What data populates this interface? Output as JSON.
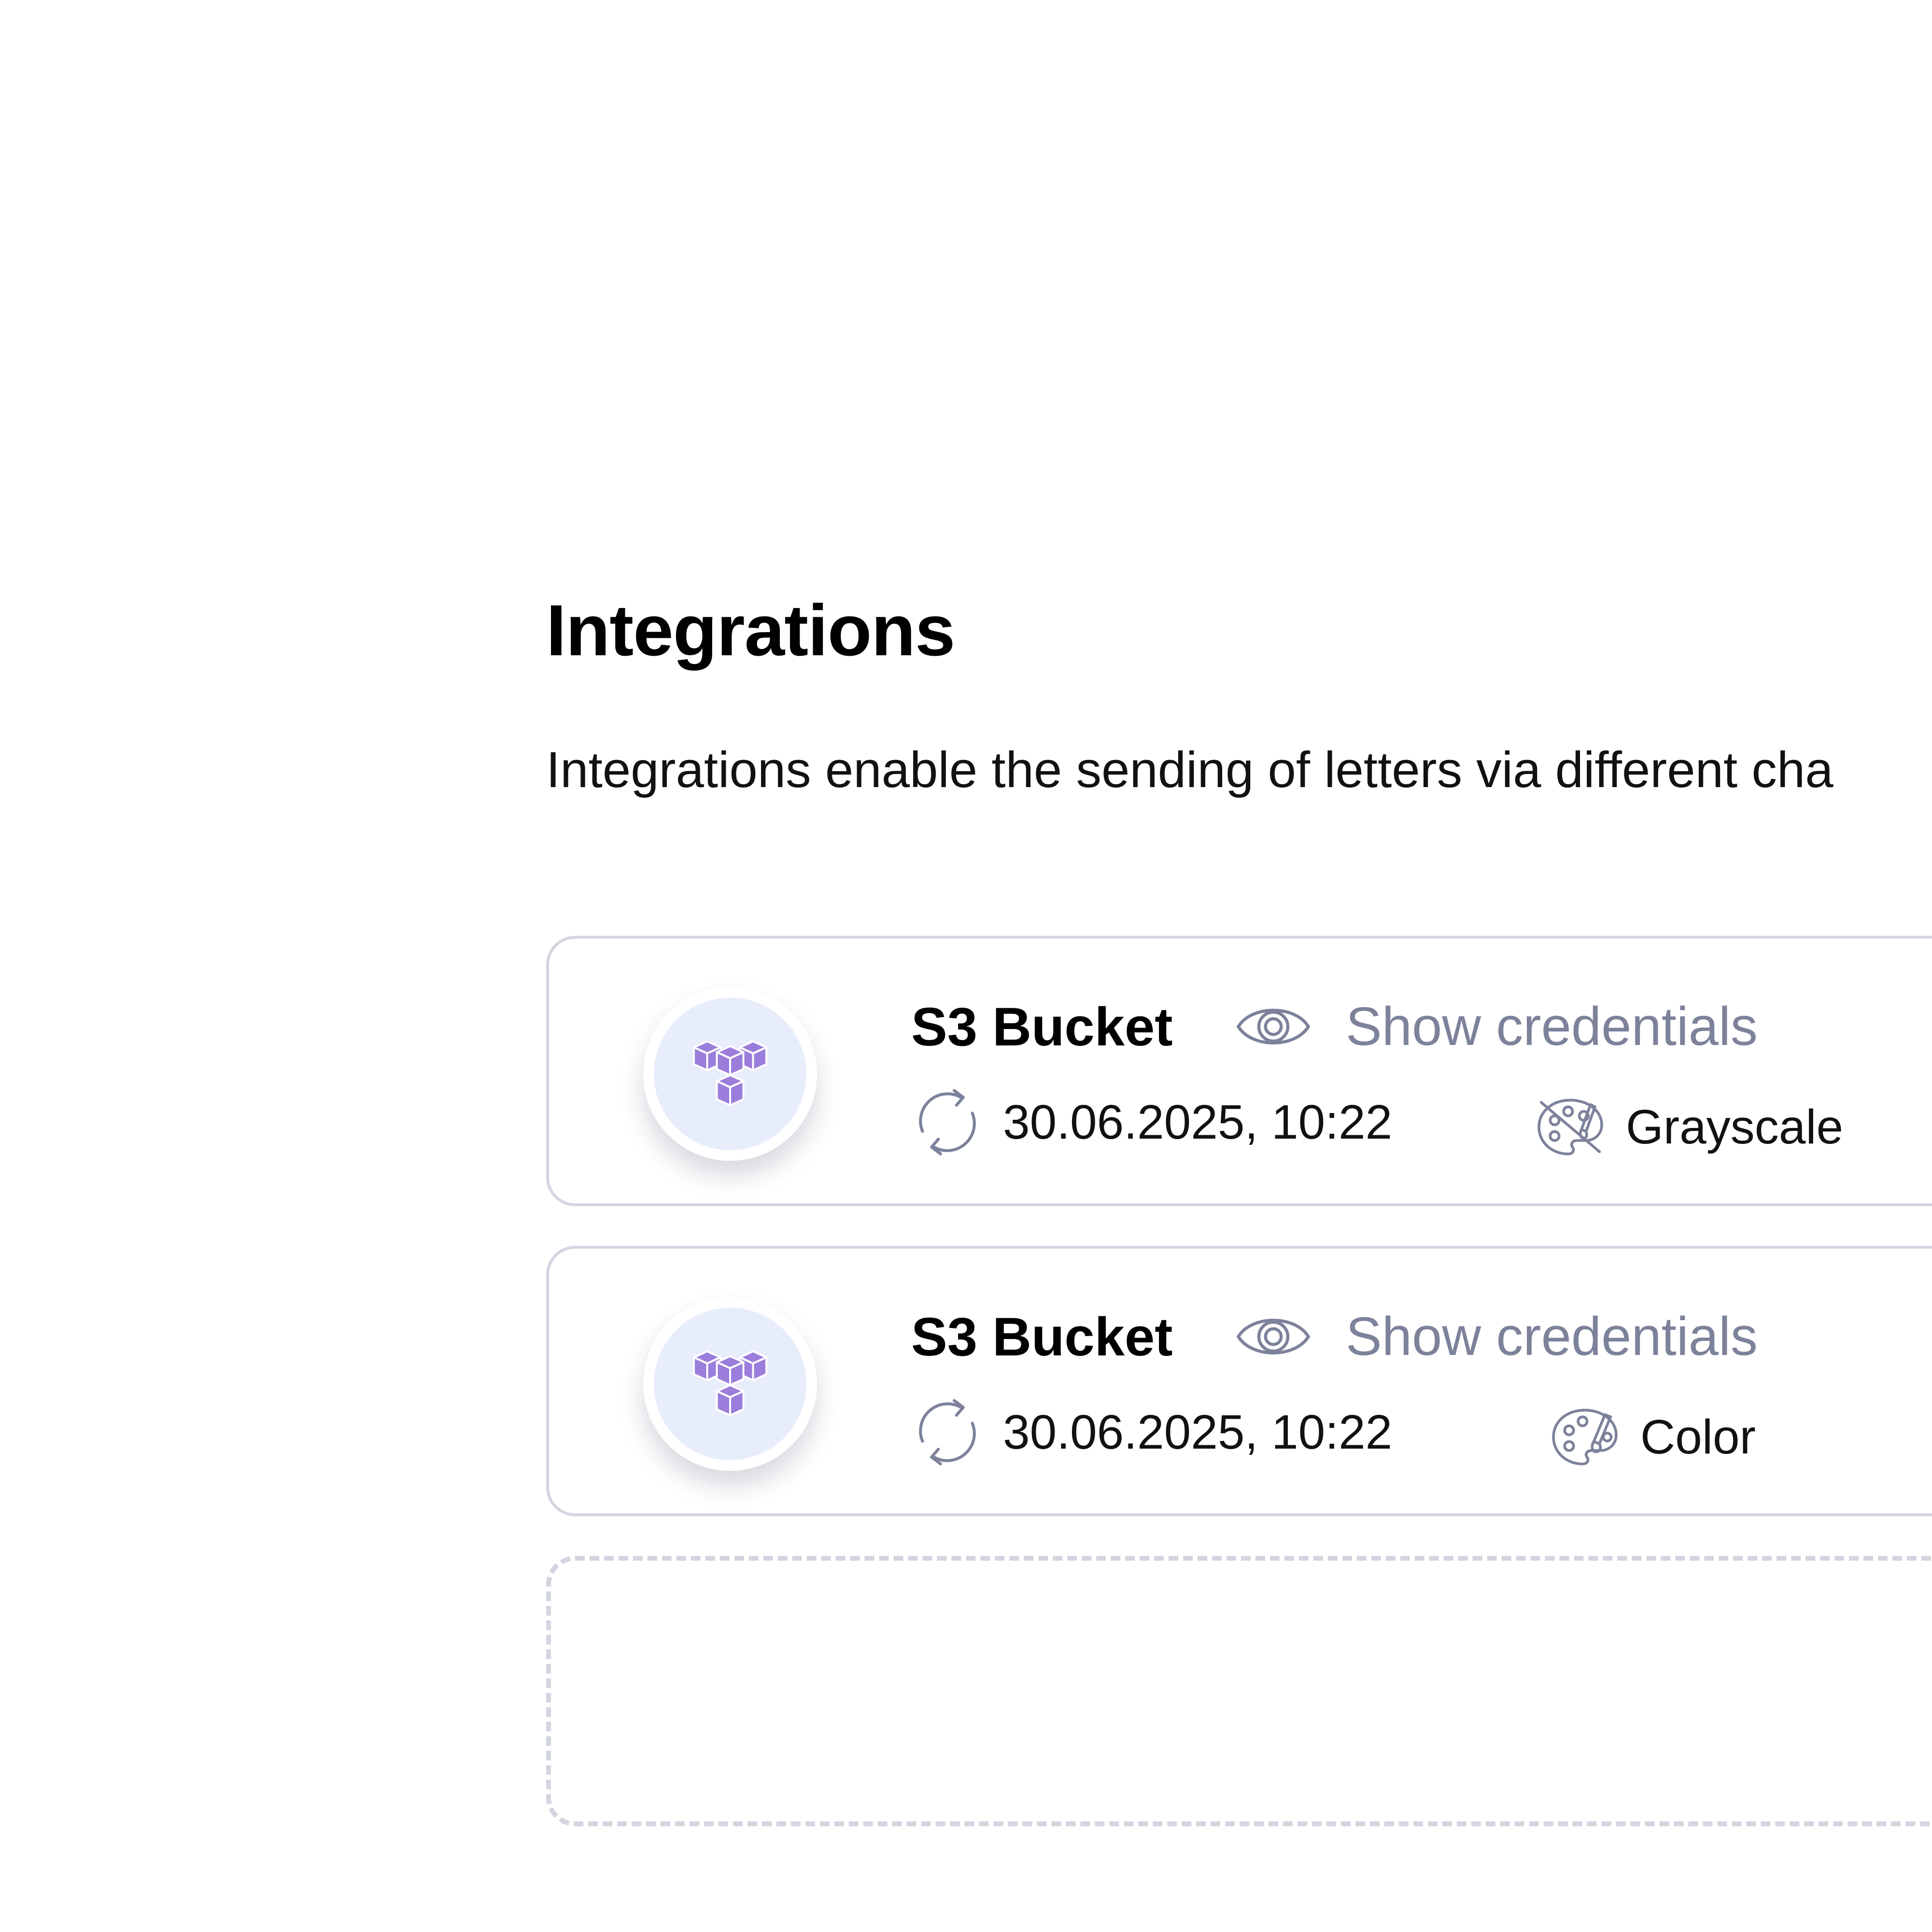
{
  "page": {
    "title": "Integrations",
    "description": "Integrations enable the sending of letters via different cha"
  },
  "colors": {
    "icon_bg": "#e8edfc",
    "brand_purple": "#9b7ddb",
    "muted_text": "#7d829b",
    "border": "#d3d5e0"
  },
  "integrations": [
    {
      "icon": "s3-bucket-icon",
      "name": "S3 Bucket",
      "show_credentials_label": "Show credentials",
      "last_sync": "30.06.2025, 10:22",
      "mode_icon": "palette-off-icon",
      "mode": "Grayscale"
    },
    {
      "icon": "s3-bucket-icon",
      "name": "S3 Bucket",
      "show_credentials_label": "Show credentials",
      "last_sync": "30.06.2025, 10:22",
      "mode_icon": "palette-icon",
      "mode": "Color"
    }
  ]
}
